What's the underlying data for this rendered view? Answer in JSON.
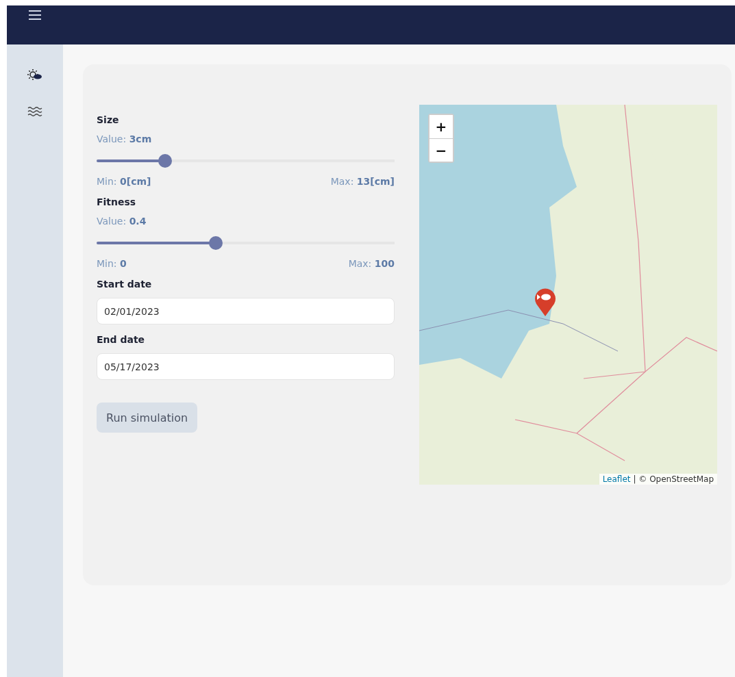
{
  "sidebar": {
    "items": [
      {
        "kind": "weather",
        "selected": false
      },
      {
        "kind": "water",
        "selected": false
      }
    ]
  },
  "form": {
    "sliders": [
      {
        "label": "Size",
        "value": "Value: **3cm**",
        "level": 0.23,
        "min": "Min: **0[cm]**",
        "max": "Max: **13[cm]**"
      },
      {
        "label": "Fitness",
        "value": "Value: **0.4**",
        "level": 0.4,
        "min": "Min: **0**",
        "max": "Max: **100**"
      }
    ],
    "dates": [
      {
        "label": "Start date",
        "value": "02/01/2023"
      },
      {
        "label": "End date",
        "value": "05/17/2023"
      }
    ],
    "button": "Run simulation"
  },
  "map": {
    "zoom_in": "+",
    "zoom_out": "−",
    "attribution_link": "Leaflet",
    "attribution": "| © OpenStreetMap"
  }
}
